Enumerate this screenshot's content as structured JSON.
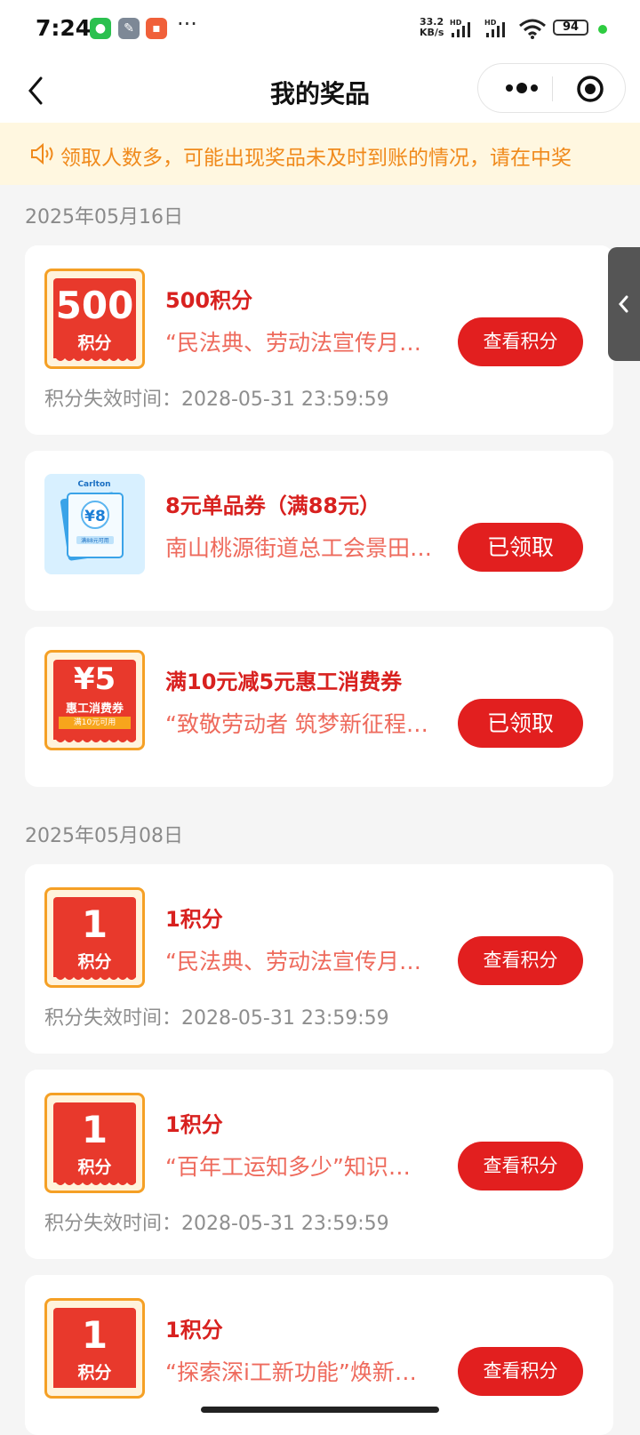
{
  "status_bar": {
    "time": "7:24",
    "net_speed_value": "33.2",
    "net_speed_unit": "KB/s",
    "sig1_label": "HD",
    "sig2_label": "HD",
    "battery": "94",
    "more": "···"
  },
  "nav": {
    "title": "我的奖品"
  },
  "notice": {
    "text": "领取人数多，可能出现奖品未及时到账的情况，请在中奖"
  },
  "colors": {
    "accent": "#e21f1f",
    "title_red": "#d8211f",
    "notice_text": "#f08a1c",
    "badge_border": "#f5a025"
  },
  "groups": [
    {
      "date": "2025年05月16日",
      "items": [
        {
          "badge_num": "500",
          "badge_unit": "积分",
          "title": "500积分",
          "subtitle": "“民法典、劳动法宣传月…",
          "expiry": "积分失效时间：2028-05-31 23:59:59",
          "button": "查看积分"
        },
        {
          "coupon_brand": "Carlton",
          "coupon_value": "¥8",
          "coupon_footer": "满88元可用",
          "title": "8元单品券（满88元）",
          "subtitle": "南山桃源街道总工会景田…",
          "button": "已领取"
        },
        {
          "badge_num": "¥5",
          "badge_unit": "惠工消费券",
          "badge_note": "满10元可用",
          "title": "满10元减5元惠工消费券",
          "subtitle": "“致敬劳动者 筑梦新征程…",
          "button": "已领取"
        }
      ]
    },
    {
      "date": "2025年05月08日",
      "items": [
        {
          "badge_num": "1",
          "badge_unit": "积分",
          "title": "1积分",
          "subtitle": "“民法典、劳动法宣传月…",
          "expiry": "积分失效时间：2028-05-31 23:59:59",
          "button": "查看积分"
        },
        {
          "badge_num": "1",
          "badge_unit": "积分",
          "title": "1积分",
          "subtitle": "“百年工运知多少”知识…",
          "expiry": "积分失效时间：2028-05-31 23:59:59",
          "button": "查看积分"
        },
        {
          "badge_num": "1",
          "badge_unit": "积分",
          "title": "1积分",
          "subtitle": "“探索深i工新功能”焕新…",
          "button": "查看积分"
        }
      ]
    }
  ]
}
